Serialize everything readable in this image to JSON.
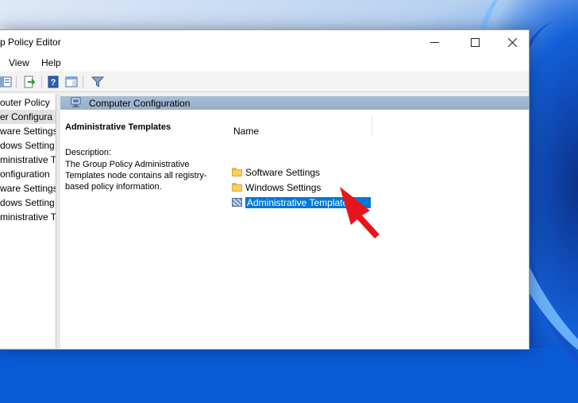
{
  "window": {
    "title": "p Policy Editor",
    "min_icon": "minimize-icon",
    "max_icon": "maximize-icon",
    "close_icon": "close-icon"
  },
  "menu": [
    "View",
    "Help"
  ],
  "toolbar_icons": [
    "back-forward-icon",
    "export-list-icon",
    "help-icon",
    "show-hide-pane-icon",
    "filter-icon"
  ],
  "tree": {
    "items": [
      {
        "label": "outer Policy",
        "selected": false
      },
      {
        "label": "er Configura",
        "selected": true
      },
      {
        "label": "ware Settings",
        "selected": false
      },
      {
        "label": "dows Setting",
        "selected": false
      },
      {
        "label": "ministrative Te",
        "selected": false
      },
      {
        "label": "onfiguration",
        "selected": false
      },
      {
        "label": "ware Settings",
        "selected": false
      },
      {
        "label": "dows Setting",
        "selected": false
      },
      {
        "label": "ministrative Te",
        "selected": false
      }
    ]
  },
  "pane": {
    "header": "Computer Configuration",
    "desc_title": "Administrative Templates",
    "desc_label": "Description:",
    "desc_text": "The Group Policy Administrative Templates node contains all registry-based policy information.",
    "column_name": "Name",
    "items": [
      {
        "label": "Software Settings",
        "icon": "folder-icon"
      },
      {
        "label": "Windows Settings",
        "icon": "folder-icon"
      },
      {
        "label": "Administrative Templates",
        "icon": "admin-templates-icon",
        "selected": true
      }
    ]
  },
  "colors": {
    "selection": "#0078d7",
    "arrow": "#e8141c",
    "header": "#a9bdd4"
  }
}
